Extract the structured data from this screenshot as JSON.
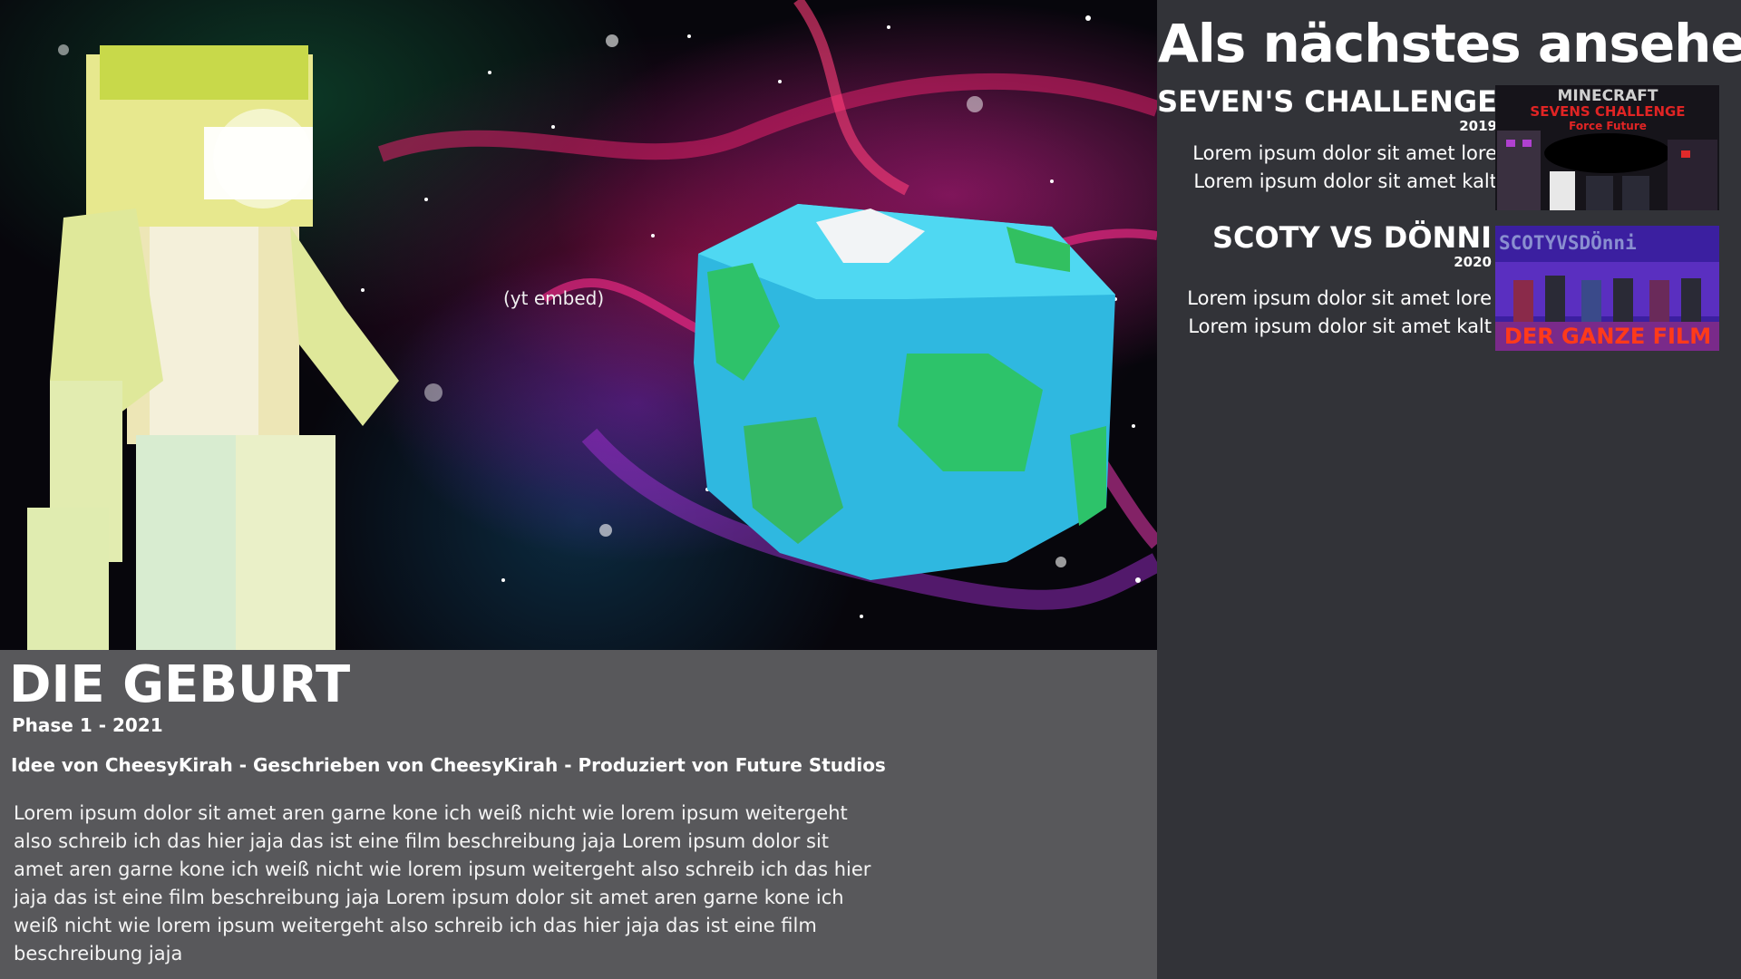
{
  "player": {
    "embed_label": "(yt embed)"
  },
  "movie": {
    "title": "DIE GEBURT",
    "phase_year": "Phase 1 - 2021",
    "credits": "Idee von CheesyKirah - Geschrieben von CheesyKirah - Produziert von Future Studios",
    "description": "Lorem ipsum dolor sit amet aren garne kone ich weiß nicht wie lorem ipsum weitergeht also schreib ich das hier jaja das ist eine film beschreibung jaja Lorem ipsum dolor sit amet aren garne kone ich weiß nicht wie lorem ipsum weitergeht also schreib ich das hier jaja das ist eine film beschreibung jaja Lorem ipsum dolor sit amet aren garne kone ich weiß nicht wie lorem ipsum weitergeht also schreib ich das hier jaja das ist eine film beschreibung jaja"
  },
  "sidebar": {
    "heading": "Als nächstes ansehen",
    "items": [
      {
        "title": "SEVEN'S CHALLENGE",
        "year": "2019",
        "desc_line1": "Lorem ipsum dolor sit amet lore",
        "desc_line2": "Lorem ipsum dolor sit amet kalt",
        "thumb_line1": "MINECRAFT",
        "thumb_line2": "SEVENS CHALLENGE",
        "thumb_line3": "Force Future"
      },
      {
        "title": "SCOTY VS DÖNNI",
        "year": "2020",
        "desc_line1": "Lorem ipsum dolor sit amet lore",
        "desc_line2": "Lorem ipsum dolor sit amet kalt",
        "thumb_line1": "SCOTYVSDÖnni",
        "thumb_line2": "DER GANZE FILM"
      }
    ]
  },
  "colors": {
    "sidebar_bg": "#323338",
    "info_bg": "#58585b",
    "text": "#ffffff"
  }
}
